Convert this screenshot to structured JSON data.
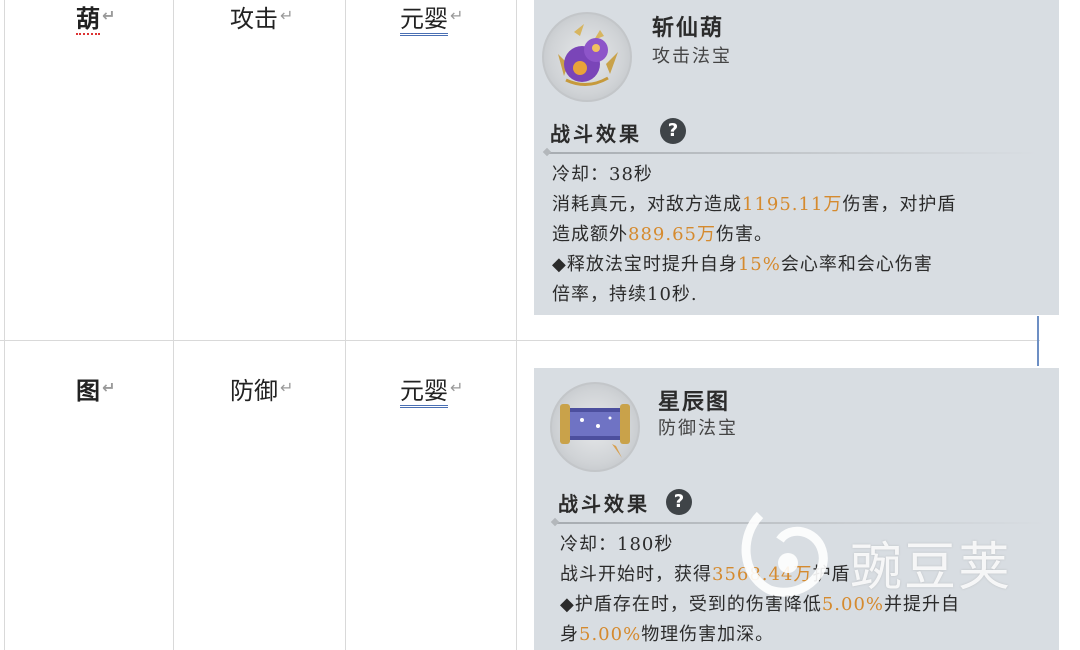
{
  "rows": [
    {
      "name_char": "葫",
      "category": "攻击",
      "realm": "元婴",
      "card": {
        "item_name": "斩仙葫",
        "item_type": "攻击法宝",
        "section_title": "战斗效果",
        "help_symbol": "?",
        "cooldown": "冷却：38秒",
        "line1_pre": "消耗真元，对敌方造成",
        "line1_hl": "1195.11万",
        "line1_post": "伤害，对护盾",
        "line2_pre": "造成额外",
        "line2_hl": "889.65万",
        "line2_post": "伤害。",
        "line3_pre": "◆释放法宝时提升自身",
        "line3_hl": "15%",
        "line3_post": "会心率和会心伤害",
        "line4": "倍率，持续10秒."
      }
    },
    {
      "name_char": "图",
      "category": "防御",
      "realm": "元婴",
      "card": {
        "item_name": "星辰图",
        "item_type": "防御法宝",
        "section_title": "战斗效果",
        "help_symbol": "?",
        "cooldown": "冷却：180秒",
        "line1_pre": "战斗开始时，获得",
        "line1_hl": "3568.44万",
        "line1_post": "护盾",
        "line2_pre": "◆护盾存在时，受到的伤害降低",
        "line2_hl": "5.00%",
        "line2_post": "并提升自",
        "line3_pre": "身",
        "line3_hl": "5.00%",
        "line3_post": "物理伤害加深。"
      }
    }
  ],
  "paragraph_mark": "↵",
  "watermark": {
    "text": "豌豆荚"
  },
  "colors": {
    "highlight": "#d58a2e",
    "card_bg": "#d8dde2",
    "underline_blue": "#4a6fb3"
  }
}
